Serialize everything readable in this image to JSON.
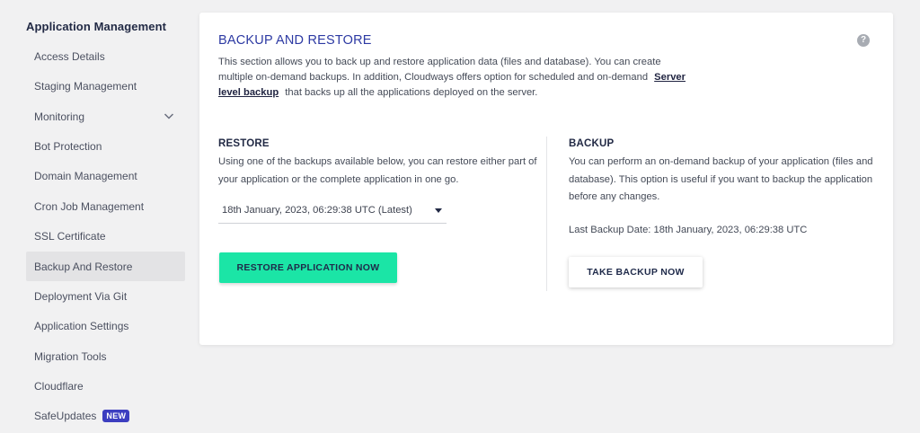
{
  "sidebar": {
    "title": "Application Management",
    "items": [
      {
        "label": "Access Details"
      },
      {
        "label": "Staging Management"
      },
      {
        "label": "Monitoring"
      },
      {
        "label": "Bot Protection"
      },
      {
        "label": "Domain Management"
      },
      {
        "label": "Cron Job Management"
      },
      {
        "label": "SSL Certificate"
      },
      {
        "label": "Backup And Restore"
      },
      {
        "label": "Deployment Via Git"
      },
      {
        "label": "Application Settings"
      },
      {
        "label": "Migration Tools"
      },
      {
        "label": "Cloudflare"
      },
      {
        "label": "SafeUpdates",
        "badge": "NEW"
      }
    ],
    "badge_color": "#3c3ec0"
  },
  "card": {
    "title": "BACKUP AND RESTORE",
    "help_icon": "question-circle-icon",
    "intro_before_link": "This section allows you to back up and restore application data (files and database). You can create multiple on-demand backups. In addition, Cloudways offers option for scheduled and on-demand",
    "intro_link": "Server level backup",
    "intro_after_link": "that backs up all the applications deployed on the server."
  },
  "restore": {
    "title": "RESTORE",
    "description": "Using one of the backups available below, you can restore either part of your application or the complete application in one go.",
    "selected_backup": "18th January, 2023, 06:29:38 UTC (Latest)",
    "button_label": "RESTORE APPLICATION NOW",
    "button_color": "#1be5a6"
  },
  "backup": {
    "title": "BACKUP",
    "description": "You can perform an on-demand backup of your application (files and database). This option is useful if you want to backup the application before any changes.",
    "last_backup": "Last Backup Date: 18th January, 2023, 06:29:38 UTC",
    "button_label": "TAKE BACKUP NOW"
  }
}
